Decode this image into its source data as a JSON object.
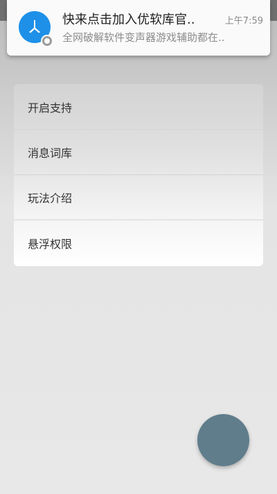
{
  "notification": {
    "title": "快来点击加入优软库官..",
    "time": "上午7:59",
    "body": "全网破解软件变声器游戏辅助都在..",
    "icon": "app-logo-icon",
    "accent_color": "#1e90e8"
  },
  "menu": {
    "items": [
      {
        "label": "开启支持"
      },
      {
        "label": "消息词库"
      },
      {
        "label": "玩法介绍"
      },
      {
        "label": "悬浮权限"
      }
    ]
  },
  "fab": {
    "icon": "fab-circle",
    "color": "#607d8b"
  }
}
